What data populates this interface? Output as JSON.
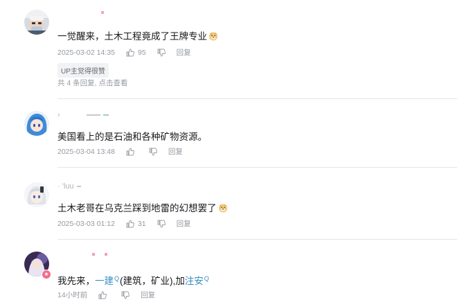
{
  "comments": [
    {
      "content": "一觉醒来，土木工程竟成了王牌专业",
      "emoji": "doge-emoji",
      "time": "2025-03-02 14:35",
      "likes": "95",
      "reply_label": "回复",
      "up_badge": "UP主觉得很赞",
      "reply_summary": "共 4 条回复,",
      "reply_view": "点击查看"
    },
    {
      "username": "›",
      "content": "美国看上的是石油和各种矿物资源。",
      "time": "2025-03-04 13:48",
      "reply_label": "回复"
    },
    {
      "username": "· 'luu",
      "content": "土木老哥在乌克兰踩到地雷的幻想罢了",
      "emoji": "doge-emoji",
      "time": "2025-03-03 01:12",
      "likes": "31",
      "reply_label": "回复"
    },
    {
      "content_parts": {
        "prefix": "我先来，",
        "link1": "一建",
        "middle": "(建筑，矿业),加",
        "link2": "注安"
      },
      "search_glyph": "Q",
      "time": "14小时前",
      "reply_label": "回复"
    }
  ],
  "colors": {
    "link": "#3a8ec2",
    "meta": "#9499a0",
    "text": "#18191c",
    "divider": "#e3e5e7"
  }
}
